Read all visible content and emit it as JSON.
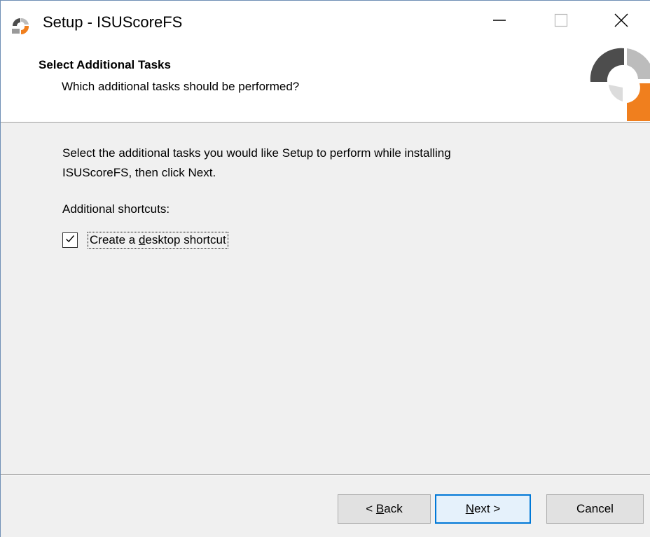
{
  "window": {
    "title": "Setup - ISUScoreFS",
    "icons": {
      "app": "setup-icon",
      "minimize": "minimize-icon",
      "maximize": "maximize-icon",
      "close": "close-icon"
    }
  },
  "header": {
    "title": "Select Additional Tasks",
    "subtitle": "Which additional tasks should be performed?",
    "logo": "isuscore-logo"
  },
  "content": {
    "intro_line1": "Select the additional tasks you would like Setup to perform while installing",
    "intro_line2": "ISUScoreFS, then click Next.",
    "group_label": "Additional shortcuts:",
    "desktop_shortcut": {
      "label_before": "Create a ",
      "label_accel": "d",
      "label_after": "esktop shortcut",
      "checked": true
    }
  },
  "buttons": {
    "back": {
      "prefix": "< ",
      "accel": "B",
      "rest": "ack"
    },
    "next": {
      "accel": "N",
      "rest": "ext >"
    },
    "cancel": "Cancel"
  },
  "colors": {
    "accent": "#0078d7",
    "logo_orange": "#f07f1e",
    "logo_dark": "#4d4d4d",
    "logo_light": "#bcbcbc"
  }
}
